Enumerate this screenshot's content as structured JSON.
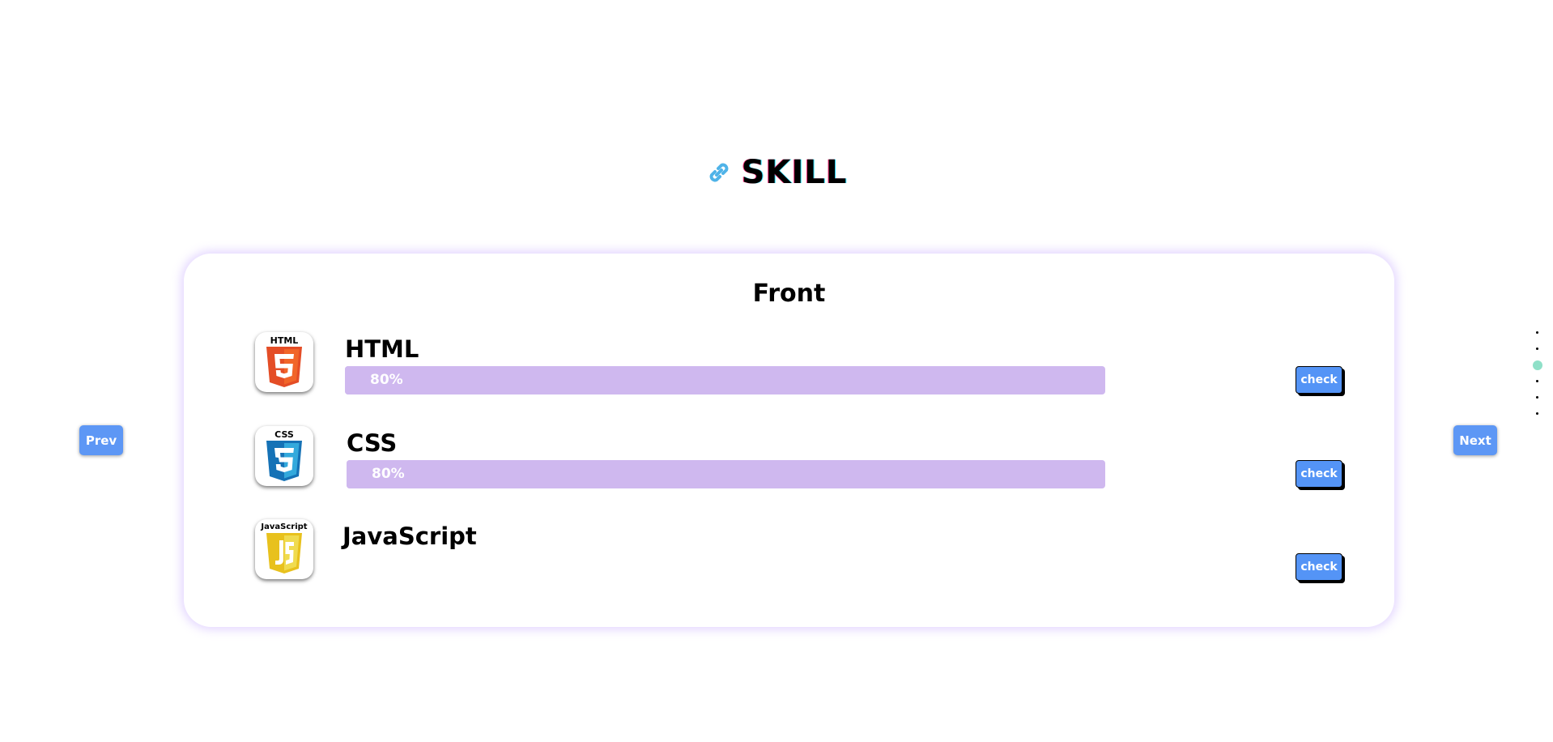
{
  "section": {
    "title": "SKILL",
    "icon": "link-icon"
  },
  "card": {
    "title": "Front",
    "skills": [
      {
        "name": "HTML",
        "logo": "html5-logo-icon",
        "logo_text": "HTML",
        "progress_label": "80%",
        "progress": 80,
        "check_label": "check"
      },
      {
        "name": "CSS",
        "logo": "css3-logo-icon",
        "logo_text": "CSS",
        "progress_label": "80%",
        "progress": 80,
        "check_label": "check"
      },
      {
        "name": "JavaScript",
        "logo": "javascript-logo-icon",
        "logo_text": "JavaScript",
        "check_label": "check"
      }
    ]
  },
  "nav": {
    "prev_label": "Prev",
    "next_label": "Next"
  },
  "pagination": {
    "count": 6,
    "active_index": 2
  },
  "colors": {
    "accent_button": "#5494f6",
    "progress_bar": "#cfb8ef",
    "active_dot": "#8fe0c8",
    "html_orange": "#e44d26",
    "css_blue": "#1572b6",
    "js_yellow": "#f0db4f"
  }
}
